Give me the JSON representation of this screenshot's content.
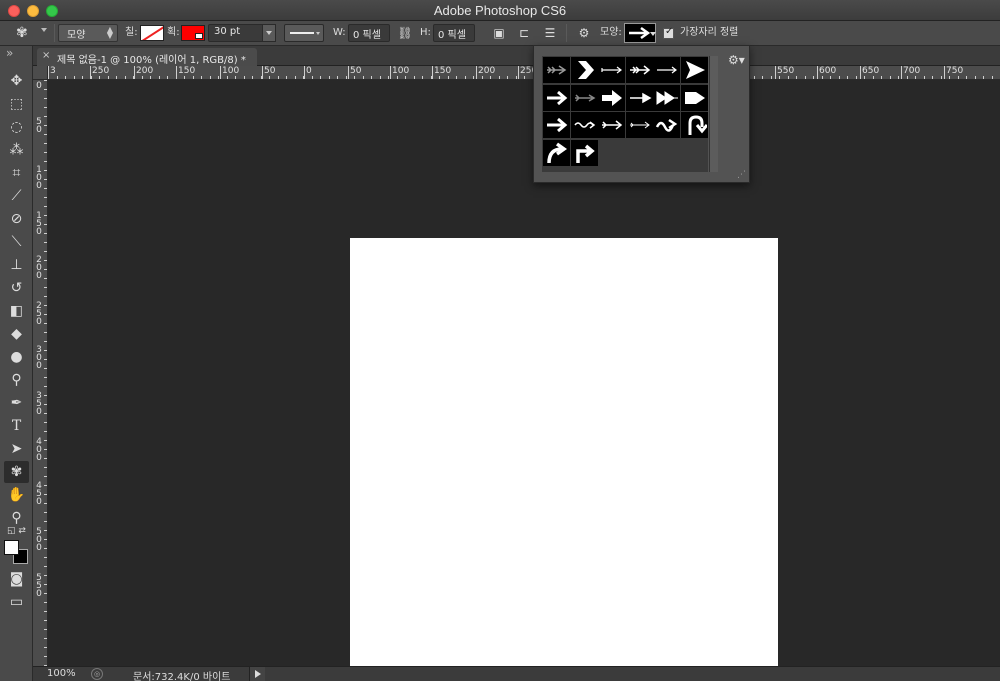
{
  "window": {
    "title": "Adobe Photoshop CS6"
  },
  "options_bar": {
    "mode_select": "모양",
    "fill_label": "칠:",
    "stroke_label": "획:",
    "stroke_size": "30 pt",
    "width_label": "W:",
    "width_value": "0 픽셀",
    "height_label": "H:",
    "height_value": "0 픽셀",
    "shape_label": "모양:",
    "align_edges_label": "가장자리 정렬",
    "fill_color": "#ffffff",
    "stroke_color": "#ff0000"
  },
  "document": {
    "tab_close": "×",
    "tab_title": "제목 없음-1 @ 100% (레이어 1, RGB/8) *"
  },
  "ruler_h": {
    "labels": [
      "3",
      "250",
      "200",
      "150",
      "100",
      "50",
      "0",
      "50",
      "100",
      "150",
      "200",
      "250",
      "550",
      "600",
      "650",
      "700",
      "750"
    ]
  },
  "ruler_v": {
    "labels": [
      "0",
      "50",
      "100",
      "150",
      "200",
      "250",
      "300",
      "350",
      "400",
      "450",
      "500",
      "550"
    ]
  },
  "tools": [
    {
      "name": "move-tool",
      "icon": "move-icon"
    },
    {
      "name": "marquee-tool",
      "icon": "marquee-icon"
    },
    {
      "name": "lasso-tool",
      "icon": "lasso-icon"
    },
    {
      "name": "magic-wand-tool",
      "icon": "magic-wand-icon"
    },
    {
      "name": "crop-tool",
      "icon": "crop-icon"
    },
    {
      "name": "eyedropper-tool",
      "icon": "eyedropper-icon"
    },
    {
      "name": "healing-tool",
      "icon": "bandage-icon"
    },
    {
      "name": "brush-tool",
      "icon": "brush-icon"
    },
    {
      "name": "stamp-tool",
      "icon": "stamp-icon"
    },
    {
      "name": "history-brush-tool",
      "icon": "history-brush-icon"
    },
    {
      "name": "eraser-tool",
      "icon": "eraser-icon"
    },
    {
      "name": "paint-bucket-tool",
      "icon": "paint-bucket-icon"
    },
    {
      "name": "blur-tool",
      "icon": "drop-icon"
    },
    {
      "name": "dodge-tool",
      "icon": "dodge-icon"
    },
    {
      "name": "pen-tool",
      "icon": "pen-icon"
    },
    {
      "name": "type-tool",
      "icon": "type-icon"
    },
    {
      "name": "path-selection-tool",
      "icon": "arrow-pointer-icon"
    },
    {
      "name": "custom-shape-tool",
      "icon": "custom-shape-icon"
    },
    {
      "name": "hand-tool",
      "icon": "hand-icon"
    },
    {
      "name": "zoom-tool",
      "icon": "magnifier-icon"
    }
  ],
  "shape_popup": {
    "shapes": [
      "arrow-1",
      "arrow-2",
      "arrow-3",
      "arrow-4",
      "arrow-5",
      "arrow-6",
      "arrow-7",
      "arrow-8",
      "arrow-9",
      "arrow-10",
      "arrow-11",
      "arrow-12",
      "arrow-13",
      "arrow-14",
      "arrow-15",
      "arrow-16",
      "arrow-17",
      "arrow-18",
      "arrow-19",
      "arrow-20"
    ]
  },
  "status": {
    "zoom": "100%",
    "doc_info": "문서:732.4K/0 바이트"
  }
}
